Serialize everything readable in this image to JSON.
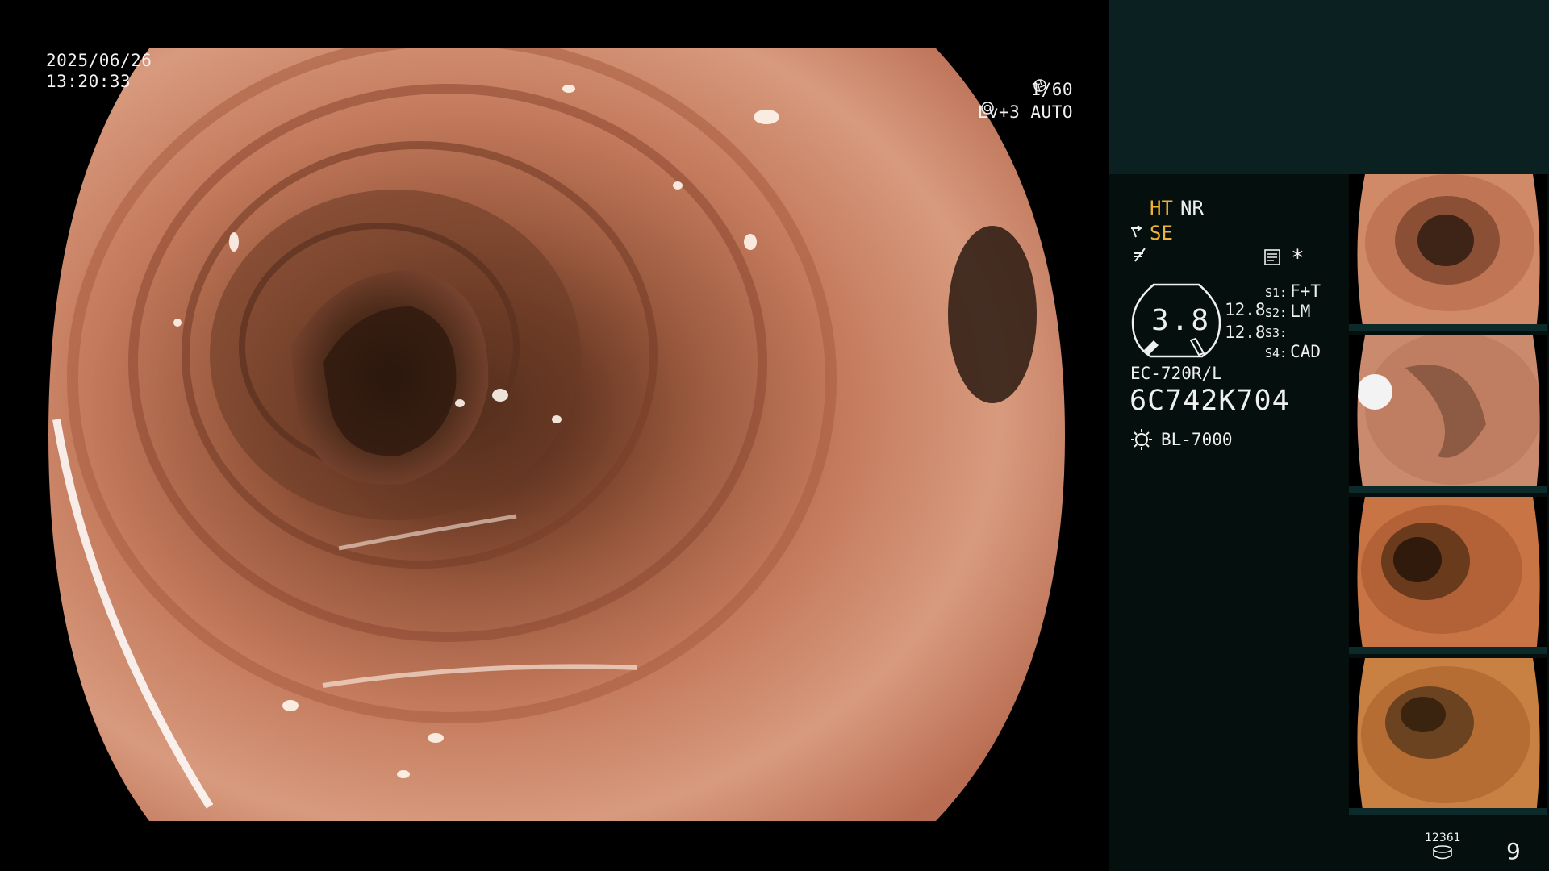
{
  "overlay": {
    "date": "2025/06/26",
    "time": "13:20:33",
    "shutter": "1/60",
    "level": "Lv+3 AUTO"
  },
  "panel": {
    "modes": {
      "ht": "HT",
      "nr": "NR",
      "se": "SE"
    },
    "star": "*",
    "dial": {
      "value": "3.8",
      "sub1": "12.8",
      "sub2": "12.8"
    },
    "switches": [
      {
        "key": "S1:",
        "value": "F+T"
      },
      {
        "key": "S2:",
        "value": "LM"
      },
      {
        "key": "S3:",
        "value": ""
      },
      {
        "key": "S4:",
        "value": "CAD"
      }
    ],
    "scope_model": "EC-720R/L",
    "scope_serial": "6C742K704",
    "light_source": "BL-7000"
  },
  "footer": {
    "storage_count": "12361",
    "image_count": "9"
  },
  "colors": {
    "panel_top": "#0b2021",
    "panel_main": "#050f0e",
    "accent_orange": "#f1b23a",
    "mucosa": "#c97a5c"
  }
}
